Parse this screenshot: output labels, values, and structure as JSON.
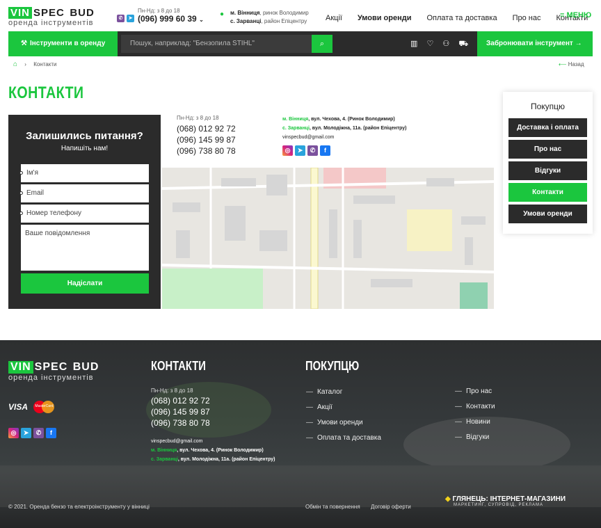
{
  "brand": {
    "vin": "VIN",
    "spec": "SPEC",
    "bud": "BUD",
    "tagline": "оренда інструментів"
  },
  "header": {
    "hours": "Пн-Нд: з 8 до 18",
    "phone": "(096) 999 60 39",
    "city1": "м. Вінниця",
    "addr1": ", ринок Володимир",
    "city2": "с. Зарванці",
    "addr2": ", район  Епіцентру",
    "nav": [
      "Акції",
      "Умови оренди",
      "Оплата та доставка",
      "Про нас",
      "Контакти"
    ],
    "menu_label": "МЕНЮ"
  },
  "bar": {
    "rent_label": "Інструменти в оренду",
    "search_placeholder": "Пошук, наприклад: \"Бензопила STIHL\"",
    "book_label": "Забронювати інструмент"
  },
  "breadcrumb": {
    "current": "Контакти",
    "back": "Назад"
  },
  "page_title": "КОНТАКТИ",
  "form": {
    "title": "Залишились питання?",
    "subtitle": "Напишіть нам!",
    "name_ph": "Ім'я",
    "email_ph": "Email",
    "phone_ph": "Номер телефону",
    "msg_ph": "Ваше повідомлення",
    "submit": "Надіслати"
  },
  "contacts": {
    "hours": "Пн-Нд: з 8 до 18",
    "phones": [
      "(068) 012 92 72",
      "(096) 145 99 87",
      "(096) 738 80 78"
    ],
    "city1": "м. Вінниця",
    "addr1": ", вул. Чехова, 4. (Ринок Володимир)",
    "city2": "с. Зарванці",
    "addr2": ", вул. Молодіжна, 11а. (район  Епіцентру)",
    "email": "vinspecbud@gmail.com"
  },
  "side": {
    "title": "Покупцю",
    "items": [
      "Доставка і оплата",
      "Про нас",
      "Відгуки",
      "Контакти",
      "Умови оренди"
    ],
    "active_index": 3
  },
  "footer": {
    "contacts_title": "КОНТАКТИ",
    "buyer_title": "ПОКУПЦЮ",
    "hours": "Пн-Нд: з 8 до 18",
    "phones": [
      "(068) 012 92 72",
      "(096) 145 99 87",
      "(096) 738 80 78"
    ],
    "email": "vinspecbud@gmail.com",
    "city1": "м. Вінниця",
    "addr1": ", вул. Чехова, 4. (Ринок Володимир)",
    "city2": "с. Зарванці",
    "addr2": ", вул. Молодіжна, 11а. (район  Епіцентру)",
    "col1": [
      "Каталог",
      "Акції",
      "Умови оренди",
      "Оплата та доставка"
    ],
    "col2": [
      "Про нас",
      "Контакти",
      "Новини",
      "Відгуки"
    ],
    "copyright": "© 2021. Оренда бензо та електроінструменту у вінниці",
    "exchange": "Обмін та повернення",
    "offer": "Договір оферти",
    "agency": "ГЛЯНЕЦЬ: ІНТЕРНЕТ-МАГАЗИНИ",
    "agency_sub": "МАРКЕТИНГ, СУПРОВІД, РЕКЛАМА",
    "visa": "VISA",
    "mastercard": "MasterCard"
  },
  "colors": {
    "accent": "#1bc63e",
    "dark": "#2b2b2b"
  }
}
